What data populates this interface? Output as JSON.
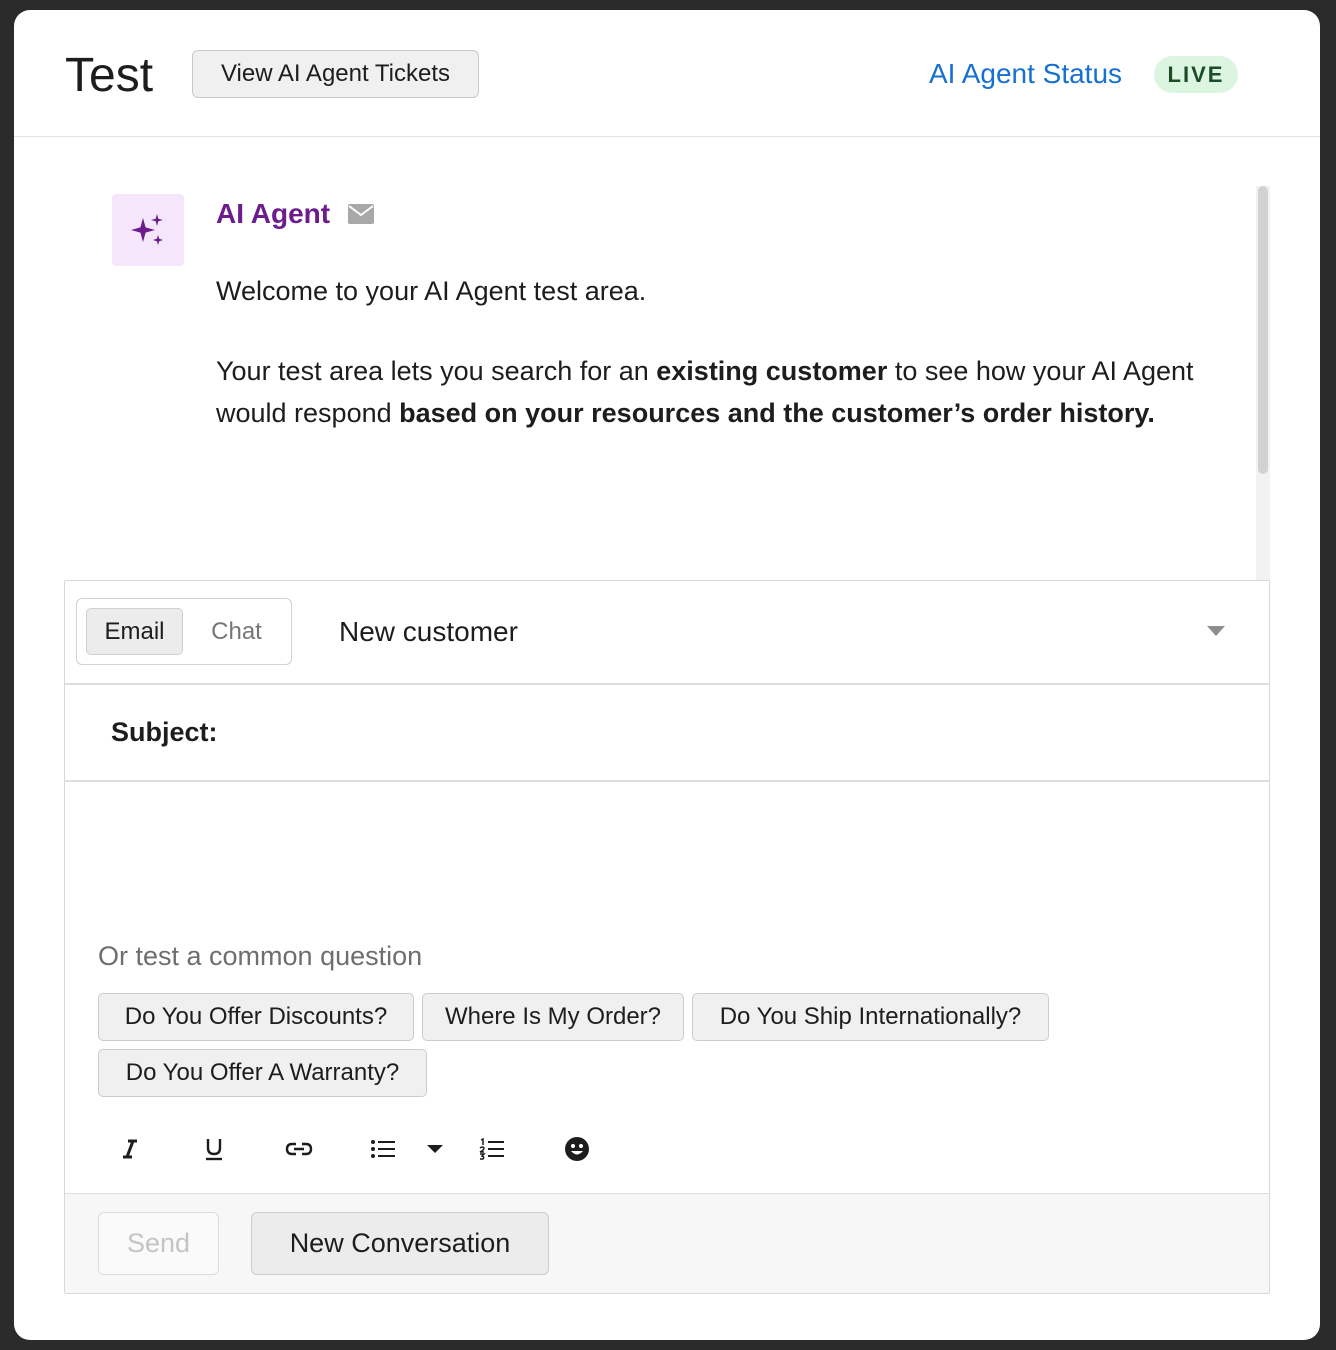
{
  "header": {
    "title": "Test",
    "view_tickets_label": "View AI Agent Tickets",
    "status_link": "AI Agent Status",
    "status_badge": "LIVE"
  },
  "message": {
    "sender": "AI Agent",
    "avatar_icon": "sparkles-icon",
    "channel_icon": "mail-icon",
    "p1": "Welcome to your AI Agent test area.",
    "p2": {
      "t1": "Your test area lets you search for an ",
      "b1": "existing customer",
      "t2": " to see how your AI Agent would respond ",
      "b2": "based on your resources and the customer’s order history."
    }
  },
  "composer": {
    "channel_tabs": {
      "email": "Email",
      "chat": "Chat",
      "selected": "Email"
    },
    "customer_select": "New customer",
    "subject_label": "Subject:",
    "common_label": "Or test a common question",
    "common_questions": [
      "Do You Offer Discounts?",
      "Where Is My Order?",
      "Do You Ship Internationally?",
      "Do You Offer A Warranty?"
    ],
    "toolbar_icons": [
      "italic-icon",
      "underline-icon",
      "link-icon",
      "bullet-list-icon",
      "chevron-down-icon",
      "numbered-list-icon",
      "emoji-icon"
    ],
    "send_label": "Send",
    "new_conversation_label": "New Conversation"
  },
  "colors": {
    "link": "#1670d0",
    "agent_name": "#6c1c8c",
    "live_badge_bg": "#dcf5e1",
    "live_badge_text": "#1c4d27",
    "avatar_bg": "#f5e6fb"
  }
}
